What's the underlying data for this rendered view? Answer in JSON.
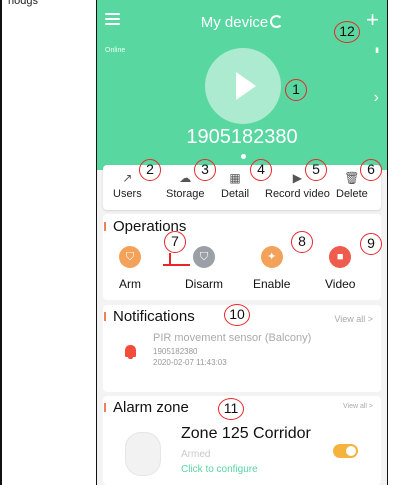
{
  "caption": "hodgs",
  "header": {
    "title": "My device",
    "status": "Online",
    "device_id": "1905182380"
  },
  "actions": [
    {
      "label": "Users",
      "icon": "share-icon"
    },
    {
      "label": "Storage",
      "icon": "cloud-icon"
    },
    {
      "label": "Detail",
      "icon": "grid-icon"
    },
    {
      "label": "Record video",
      "icon": "play-icon"
    },
    {
      "label": "Delete",
      "icon": "trash-icon"
    }
  ],
  "operations": {
    "title": "Operations",
    "items": [
      {
        "label": "Arm",
        "color": "#f4a25a"
      },
      {
        "label": "Disarm",
        "color": "#9aa0a6"
      },
      {
        "label": "Enable",
        "color": "#f4a25a"
      },
      {
        "label": "Video",
        "color": "#ef5b4d"
      }
    ]
  },
  "notifications": {
    "title": "Notifications",
    "view_all": "View all >",
    "item": {
      "text": "PIR movement sensor (Balcony)",
      "device": "1905182380",
      "time": "2020-02-07 11:43:03"
    }
  },
  "alarm_zone": {
    "title": "Alarm zone",
    "view_all": "View all >",
    "zone": {
      "name": "Zone 125 Corridor",
      "status": "Armed",
      "action": "Click to configure",
      "enabled": true
    }
  },
  "markers": [
    "1",
    "2",
    "3",
    "4",
    "5",
    "6",
    "7",
    "8",
    "9",
    "10",
    "11",
    "12"
  ],
  "colors": {
    "header": "#58d7a1",
    "marker": "#e8262a",
    "accent": "#f07f60"
  }
}
